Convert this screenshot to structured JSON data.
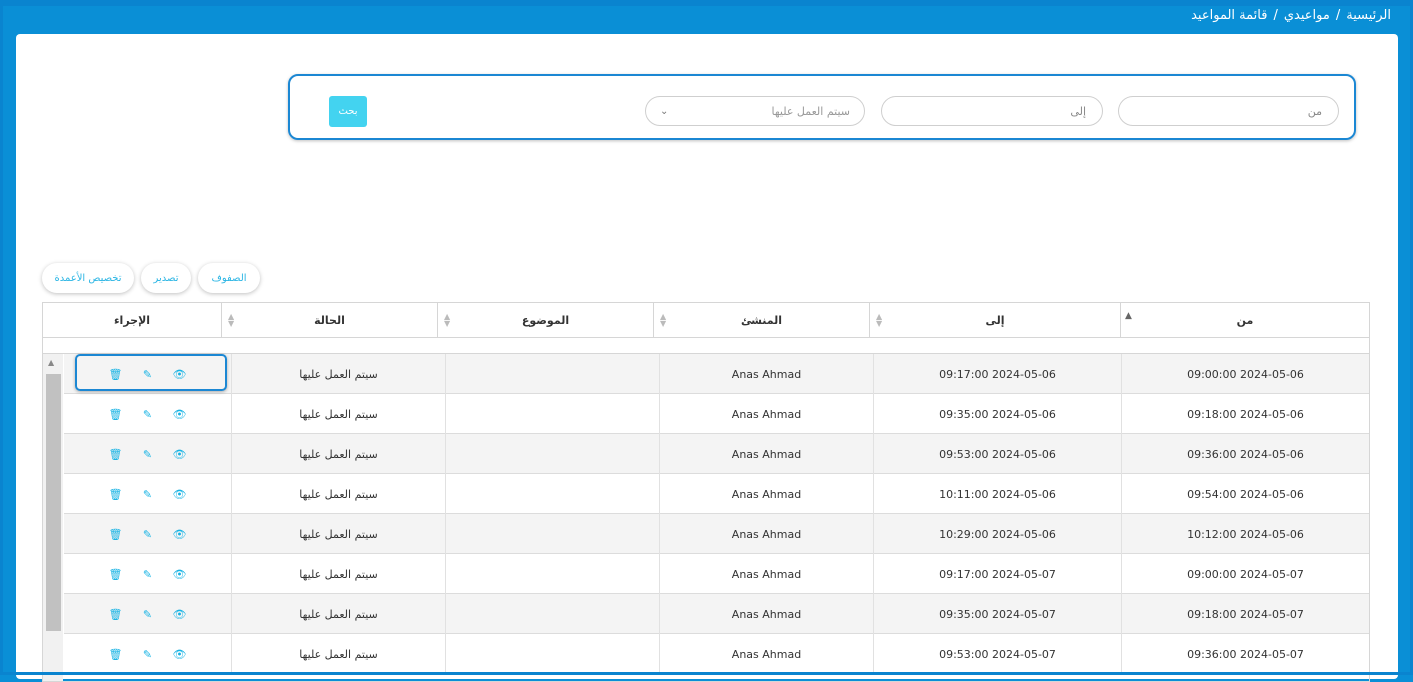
{
  "breadcrumb": [
    "الرئيسية",
    "مواعيدي",
    "قائمة المواعيد"
  ],
  "filters": {
    "from_placeholder": "من",
    "to_placeholder": "إلى",
    "status_value": "سيتم العمل عليها",
    "search_label": "بحث"
  },
  "toolbar": {
    "rows_label": "الصفوف",
    "export_label": "تصدير",
    "columns_label": "تخصيص الأعمدة"
  },
  "table": {
    "headers": {
      "from": "من",
      "to": "إلى",
      "creator": "المنشئ",
      "subject": "الموضوع",
      "status": "الحالة",
      "action": "الإجراء"
    },
    "rows": [
      {
        "from": "2024-05-06 09:00:00",
        "to": "2024-05-06 09:17:00",
        "creator": "Anas Ahmad",
        "subject": "",
        "status": "سيتم العمل عليها"
      },
      {
        "from": "2024-05-06 09:18:00",
        "to": "2024-05-06 09:35:00",
        "creator": "Anas Ahmad",
        "subject": "",
        "status": "سيتم العمل عليها"
      },
      {
        "from": "2024-05-06 09:36:00",
        "to": "2024-05-06 09:53:00",
        "creator": "Anas Ahmad",
        "subject": "",
        "status": "سيتم العمل عليها"
      },
      {
        "from": "2024-05-06 09:54:00",
        "to": "2024-05-06 10:11:00",
        "creator": "Anas Ahmad",
        "subject": "",
        "status": "سيتم العمل عليها"
      },
      {
        "from": "2024-05-06 10:12:00",
        "to": "2024-05-06 10:29:00",
        "creator": "Anas Ahmad",
        "subject": "",
        "status": "سيتم العمل عليها"
      },
      {
        "from": "2024-05-07 09:00:00",
        "to": "2024-05-07 09:17:00",
        "creator": "Anas Ahmad",
        "subject": "",
        "status": "سيتم العمل عليها"
      },
      {
        "from": "2024-05-07 09:18:00",
        "to": "2024-05-07 09:35:00",
        "creator": "Anas Ahmad",
        "subject": "",
        "status": "سيتم العمل عليها"
      },
      {
        "from": "2024-05-07 09:36:00",
        "to": "2024-05-07 09:53:00",
        "creator": "Anas Ahmad",
        "subject": "",
        "status": "سيتم العمل عليها"
      }
    ]
  },
  "icons": {
    "view": "eye-icon",
    "edit": "pencil-icon",
    "delete": "trash-icon"
  },
  "colors": {
    "header_blue": "#0a8fd6",
    "accent_cyan": "#17b3e4",
    "highlight_border": "#1b87d3"
  }
}
